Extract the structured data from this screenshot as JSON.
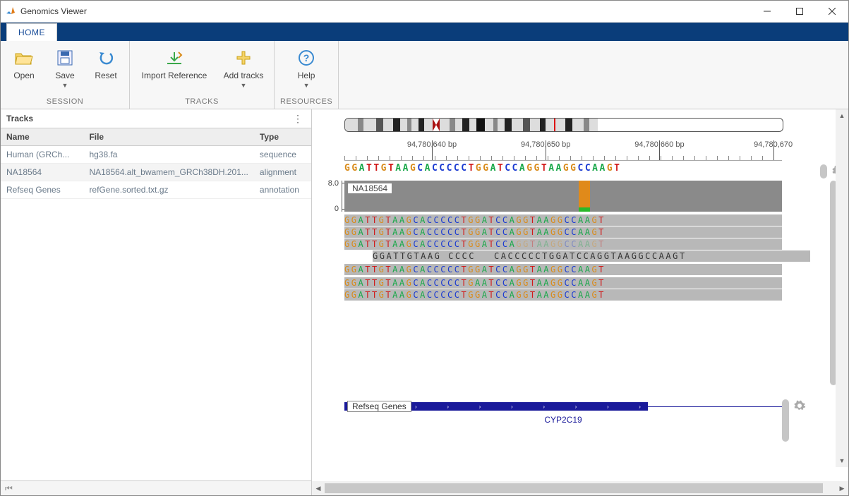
{
  "window": {
    "title": "Genomics Viewer"
  },
  "tabs": {
    "home": "HOME"
  },
  "ribbon": {
    "session": {
      "label": "SESSION",
      "open": "Open",
      "save": "Save",
      "reset": "Reset"
    },
    "tracks": {
      "label": "TRACKS",
      "import_ref": "Import Reference",
      "add_tracks": "Add tracks"
    },
    "resources": {
      "label": "RESOURCES",
      "help": "Help"
    }
  },
  "sidebar": {
    "title": "Tracks",
    "columns": {
      "name": "Name",
      "file": "File",
      "type": "Type"
    },
    "rows": [
      {
        "name": "Human (GRCh...",
        "file": "hg38.fa",
        "type": "sequence"
      },
      {
        "name": "NA18564",
        "file": "NA18564.alt_bwamem_GRCh38DH.201...",
        "type": "alignment"
      },
      {
        "name": "Refseq Genes",
        "file": "refGene.sorted.txt.gz",
        "type": "annotation"
      }
    ]
  },
  "ruler": {
    "ticks": [
      {
        "pos_pct": 20,
        "label": "94,780,640 bp"
      },
      {
        "pos_pct": 46,
        "label": "94,780,650 bp"
      },
      {
        "pos_pct": 72,
        "label": "94,780,660 bp"
      },
      {
        "pos_pct": 98,
        "label": "94,780,670"
      }
    ]
  },
  "reference_seq": "GGATTGTAAGCACCCCCTGGATCCAGGTAAGGCCAAGT",
  "coverage": {
    "label": "NA18564",
    "ymax": "8.0",
    "ymin": "0",
    "highlight": {
      "left_pct": 53.5,
      "orange_h": 100,
      "green_h": 14
    }
  },
  "reads": [
    {
      "seq": "GGATTGTAAGCACCCCCTGGATCCAGGTAAGGCCAAGT",
      "faded_from": 99
    },
    {
      "seq": "GGATTGTAAGCACCCCCTGGATCCAGGTAAGGCCAAGT",
      "faded_from": 99
    },
    {
      "seq": "GGATTGTAAGCACCCCCTGGATCCAGGTAAGGCCAAGT",
      "faded_from": 25
    },
    {
      "seq": "GGATTGTAAGCACCCCCTGGATCCAGGTAAGGCCAAGT",
      "faded_from": 99
    },
    {
      "seq": "GGATTGTAAGCACCCCCTGAATCCAGGTAAGGCCAAGT",
      "faded_from": 99
    },
    {
      "seq": "GGATTGTAAGCACCCCCTGGATCCAGGTAAGGCCAAGT",
      "faded_from": 99
    }
  ],
  "read4": {
    "left": "GGATTGTAAG CCCC",
    "right": "CACCCCCTGGATCCAGGTAAGGCCAAGT"
  },
  "refseq_track": {
    "label": "Refseq Genes",
    "gene": "CYP2C19"
  },
  "ideogram_bands": [
    {
      "w": 18,
      "c": "#ddd"
    },
    {
      "w": 8,
      "c": "#888"
    },
    {
      "w": 18,
      "c": "#ddd"
    },
    {
      "w": 10,
      "c": "#555"
    },
    {
      "w": 14,
      "c": "#ddd"
    },
    {
      "w": 10,
      "c": "#222"
    },
    {
      "w": 10,
      "c": "#ddd"
    },
    {
      "w": 6,
      "c": "#888"
    },
    {
      "w": 10,
      "c": "#ddd"
    },
    {
      "w": 8,
      "c": "#222"
    },
    {
      "w": 12,
      "c": "#ddd"
    },
    {
      "w": 10,
      "c": "cent"
    },
    {
      "w": 14,
      "c": "#ddd"
    },
    {
      "w": 8,
      "c": "#888"
    },
    {
      "w": 10,
      "c": "#ddd"
    },
    {
      "w": 10,
      "c": "#222"
    },
    {
      "w": 10,
      "c": "#ddd"
    },
    {
      "w": 12,
      "c": "#111"
    },
    {
      "w": 12,
      "c": "#ddd"
    },
    {
      "w": 6,
      "c": "#888"
    },
    {
      "w": 10,
      "c": "#ddd"
    },
    {
      "w": 10,
      "c": "#222"
    },
    {
      "w": 16,
      "c": "#ddd"
    },
    {
      "w": 10,
      "c": "#555"
    },
    {
      "w": 14,
      "c": "#ddd"
    },
    {
      "w": 8,
      "c": "#222"
    },
    {
      "w": 12,
      "c": "#ddd"
    },
    {
      "w": 2,
      "c": "#d11"
    },
    {
      "w": 14,
      "c": "#ddd"
    },
    {
      "w": 10,
      "c": "#222"
    },
    {
      "w": 16,
      "c": "#ddd"
    },
    {
      "w": 8,
      "c": "#888"
    },
    {
      "w": 12,
      "c": "#ddd"
    }
  ]
}
